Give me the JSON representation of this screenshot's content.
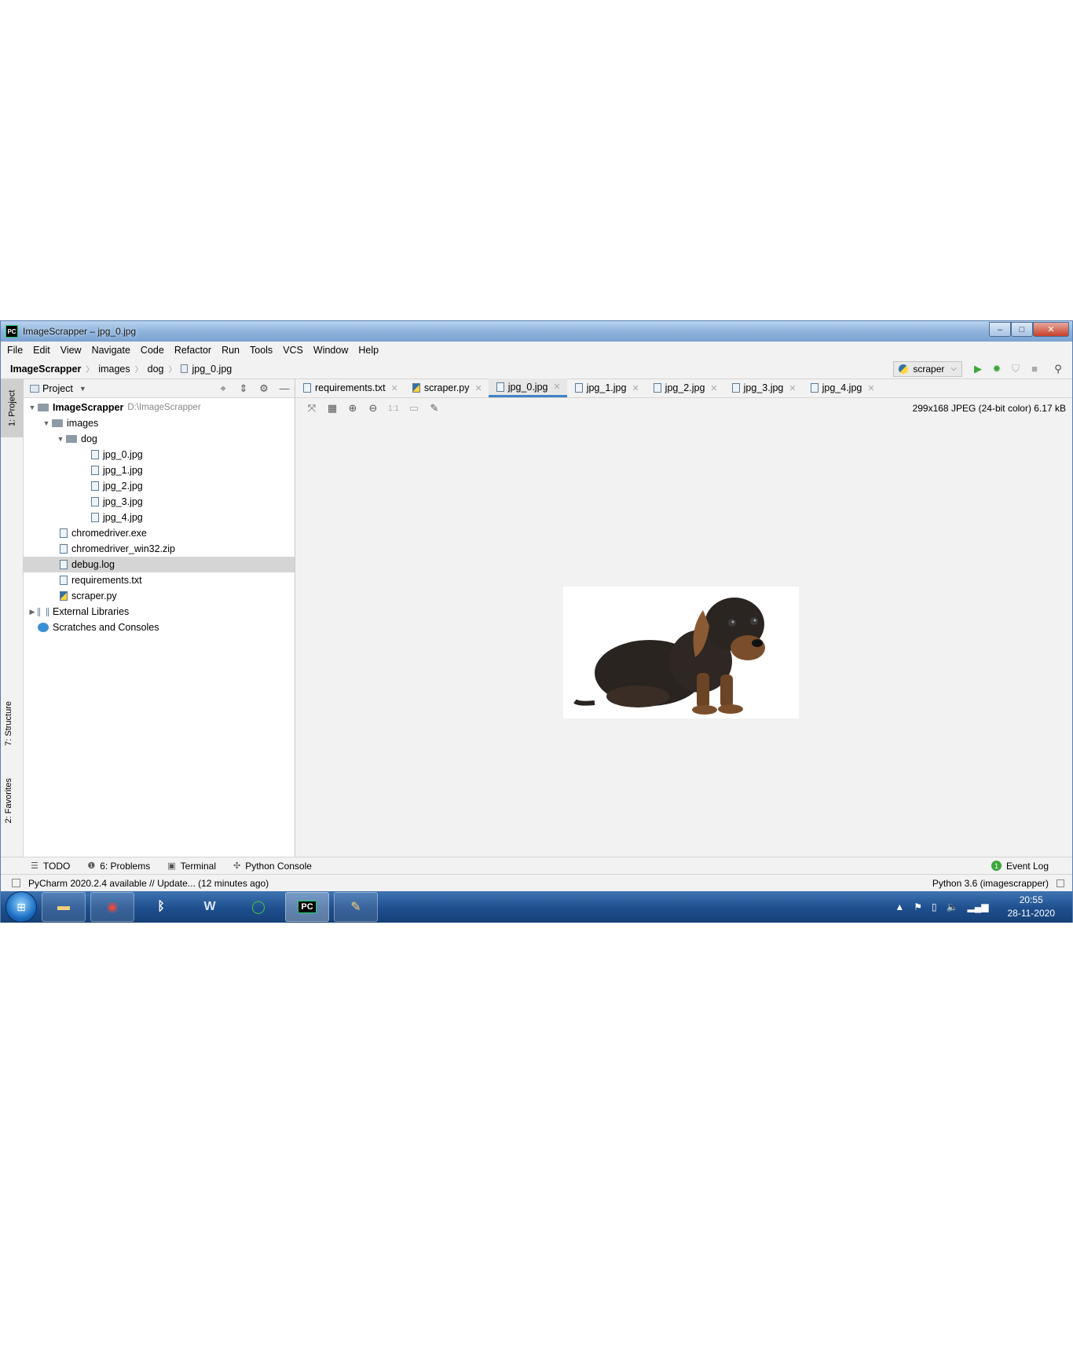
{
  "window": {
    "title": "ImageScrapper – jpg_0.jpg",
    "app_logo": "PC",
    "minimize": "–",
    "maximize": "□",
    "close": "✕"
  },
  "menu": [
    "File",
    "Edit",
    "View",
    "Navigate",
    "Code",
    "Refactor",
    "Run",
    "Tools",
    "VCS",
    "Window",
    "Help"
  ],
  "breadcrumb": {
    "project": "ImageScrapper",
    "folder1": "images",
    "folder2": "dog",
    "file": "jpg_0.jpg"
  },
  "run_config": "scraper",
  "left_strip": {
    "project_tab": "1: Project",
    "structure_tab": "7: Structure",
    "favorites_tab": "2: Favorites"
  },
  "project_panel": {
    "title": "Project",
    "root": {
      "name": "ImageScrapper",
      "path": "D:\\ImageScrapper"
    },
    "images": "images",
    "dog": "dog",
    "dog_files": [
      "jpg_0.jpg",
      "jpg_1.jpg",
      "jpg_2.jpg",
      "jpg_3.jpg",
      "jpg_4.jpg"
    ],
    "root_files": [
      "chromedriver.exe",
      "chromedriver_win32.zip",
      "debug.log",
      "requirements.txt",
      "scraper.py"
    ],
    "external_libraries": "External Libraries",
    "scratches": "Scratches and Consoles"
  },
  "editor_tabs": [
    "requirements.txt",
    "scraper.py",
    "jpg_0.jpg",
    "jpg_1.jpg",
    "jpg_2.jpg",
    "jpg_3.jpg",
    "jpg_4.jpg"
  ],
  "image_toolbar": {
    "actual_size": "1:1"
  },
  "image_info": "299x168 JPEG (24-bit color) 6.17 kB",
  "bottom_tabs": {
    "todo": "TODO",
    "problems": "6: Problems",
    "terminal": "Terminal",
    "python_console": "Python Console",
    "event_log_count": "1",
    "event_log": "Event Log"
  },
  "status": {
    "message": "PyCharm 2020.2.4 available // Update... (12 minutes ago)",
    "interpreter": "Python 3.6 (imagescrapper)"
  },
  "taskbar": {
    "pycharm": "PC",
    "time": "20:55",
    "date": "28-11-2020"
  }
}
